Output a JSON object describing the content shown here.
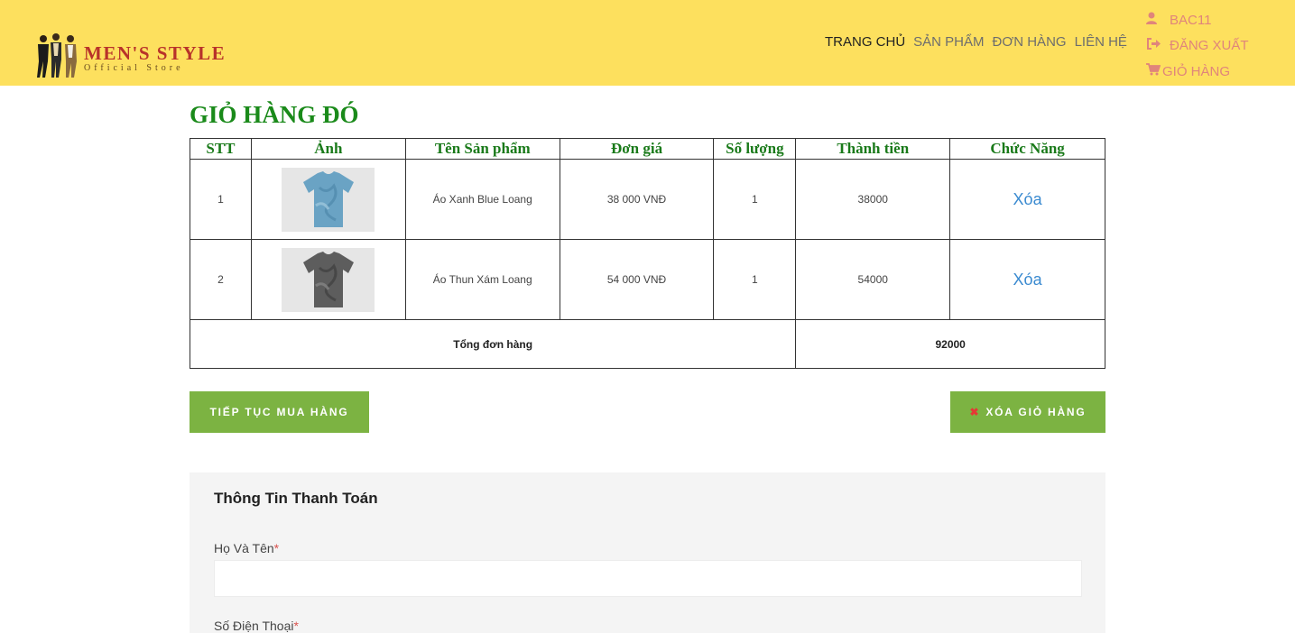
{
  "header": {
    "logo": {
      "title": "MEN'S STYLE",
      "subtitle": "Official Store"
    },
    "nav": [
      "TRANG CHỦ",
      "SẢN PHẨM",
      "ĐƠN HÀNG",
      "LIÊN HỆ"
    ],
    "nav_active": "TRANG CHỦ",
    "user": {
      "username": "BAC11",
      "logout": "ĐĂNG XUẤT",
      "cart": "GIỎ HÀNG"
    },
    "colors": {
      "background": "#fde05e",
      "user_menu": "#e0857b"
    }
  },
  "cart": {
    "title": "GIỎ HÀNG ĐÓ",
    "columns": [
      "STT",
      "Ảnh",
      "Tên Sản phẩm",
      "Đơn giá",
      "Số lượng",
      "Thành tiền",
      "Chức Năng"
    ],
    "rows": [
      {
        "stt": "1",
        "image_icon": "tshirt-blue-tie-dye",
        "name": "Áo Xanh Blue Loang",
        "price": "38 000 VNĐ",
        "qty": "1",
        "subtotal": "38000",
        "action": "Xóa"
      },
      {
        "stt": "2",
        "image_icon": "tshirt-gray-tie-dye",
        "name": "Áo Thun Xám Loang",
        "price": "54 000 VNĐ",
        "qty": "1",
        "subtotal": "54000",
        "action": "Xóa"
      }
    ],
    "total_label": "Tổng đơn hàng",
    "total_value": "92000"
  },
  "buttons": {
    "continue": "TIẾP TỤC MUA HÀNG",
    "clear": "XÓA GIỎ HÀNG"
  },
  "checkout": {
    "title": "Thông Tin Thanh Toán",
    "fields": [
      {
        "label": "Họ Và Tên",
        "required_mark": "*",
        "value": ""
      },
      {
        "label": "Số Điện Thoại",
        "required_mark": "*",
        "value": ""
      }
    ]
  },
  "colors": {
    "title_green": "#1a8a1a",
    "button_green": "#7cb342",
    "link_blue": "#3a8ad0"
  }
}
